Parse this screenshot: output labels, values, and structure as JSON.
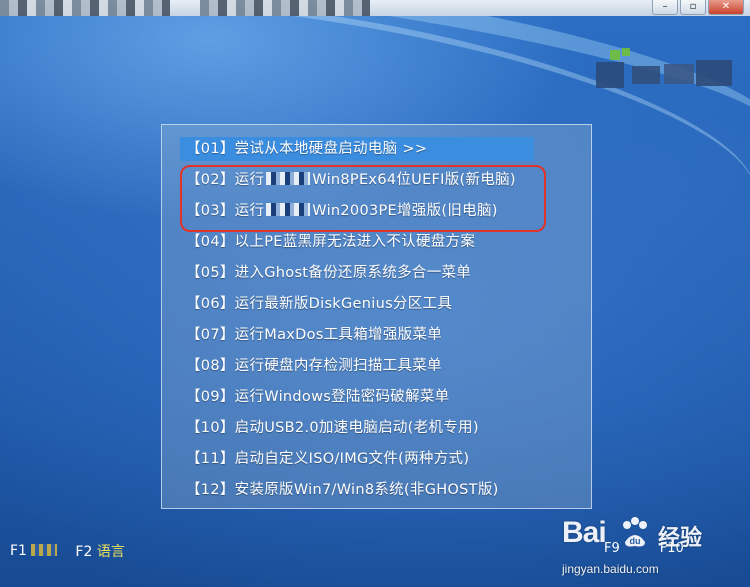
{
  "menu": {
    "items": [
      {
        "num": "【01】",
        "pre": "尝试从本地硬盘启动电脑 >>",
        "post": "",
        "blurred": false,
        "selected": true
      },
      {
        "num": "【02】",
        "pre": "运行",
        "post": "Win8PEx64位UEFI版(新电脑)",
        "blurred": true,
        "selected": false
      },
      {
        "num": "【03】",
        "pre": "运行",
        "post": "Win2003PE增强版(旧电脑)",
        "blurred": true,
        "selected": false
      },
      {
        "num": "【04】",
        "pre": "以上PE蓝黑屏无法进入不认硬盘方案",
        "post": "",
        "blurred": false,
        "selected": false
      },
      {
        "num": "【05】",
        "pre": "进入Ghost备份还原系统多合一菜单",
        "post": "",
        "blurred": false,
        "selected": false
      },
      {
        "num": "【06】",
        "pre": "运行最新版DiskGenius分区工具",
        "post": "",
        "blurred": false,
        "selected": false
      },
      {
        "num": "【07】",
        "pre": "运行MaxDos工具箱增强版菜单",
        "post": "",
        "blurred": false,
        "selected": false
      },
      {
        "num": "【08】",
        "pre": "运行硬盘内存检测扫描工具菜单",
        "post": "",
        "blurred": false,
        "selected": false
      },
      {
        "num": "【09】",
        "pre": "运行Windows登陆密码破解菜单",
        "post": "",
        "blurred": false,
        "selected": false
      },
      {
        "num": "【10】",
        "pre": "启动USB2.0加速电脑启动(老机专用)",
        "post": "",
        "blurred": false,
        "selected": false
      },
      {
        "num": "【11】",
        "pre": "启动自定义ISO/IMG文件(两种方式)",
        "post": "",
        "blurred": false,
        "selected": false
      },
      {
        "num": "【12】",
        "pre": "安装原版Win7/Win8系统(非GHOST版)",
        "post": "",
        "blurred": false,
        "selected": false
      }
    ]
  },
  "footer": {
    "f1_key": "F1",
    "f2_key": "F2",
    "f2_label": "语言",
    "f9_key": "F9",
    "f10_key": "F10"
  },
  "watermark": {
    "brand": "Bai",
    "name": "经验",
    "url": "jingyan.baidu.com"
  },
  "colors": {
    "selected_bg": "#3b8de0",
    "annotation_ring": "#e0332a",
    "lang_label": "#f1e55b"
  }
}
